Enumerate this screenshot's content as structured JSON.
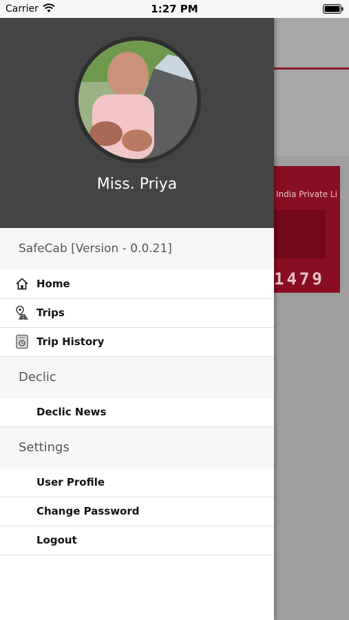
{
  "status_bar": {
    "carrier": "Carrier",
    "time": "1:27 PM",
    "icons": [
      "wifi-icon",
      "battery-icon"
    ]
  },
  "background_app": {
    "card_company": "India Private Li",
    "card_number": "1479",
    "accent_color": "#8a0e22"
  },
  "drawer": {
    "profile": {
      "name": "Miss. Priya",
      "header_color": "#444444"
    },
    "app_version": "SafeCab [Version - 0.0.21]",
    "main_items": [
      {
        "label": "Home",
        "icon": "home-icon"
      },
      {
        "label": "Trips",
        "icon": "map-pin-icon"
      },
      {
        "label": "Trip History",
        "icon": "history-icon"
      }
    ],
    "sections": [
      {
        "title": "Declic",
        "items": [
          {
            "label": "Declic News"
          }
        ]
      },
      {
        "title": "Settings",
        "items": [
          {
            "label": "User Profile"
          },
          {
            "label": "Change Password"
          },
          {
            "label": "Logout"
          }
        ]
      }
    ]
  }
}
